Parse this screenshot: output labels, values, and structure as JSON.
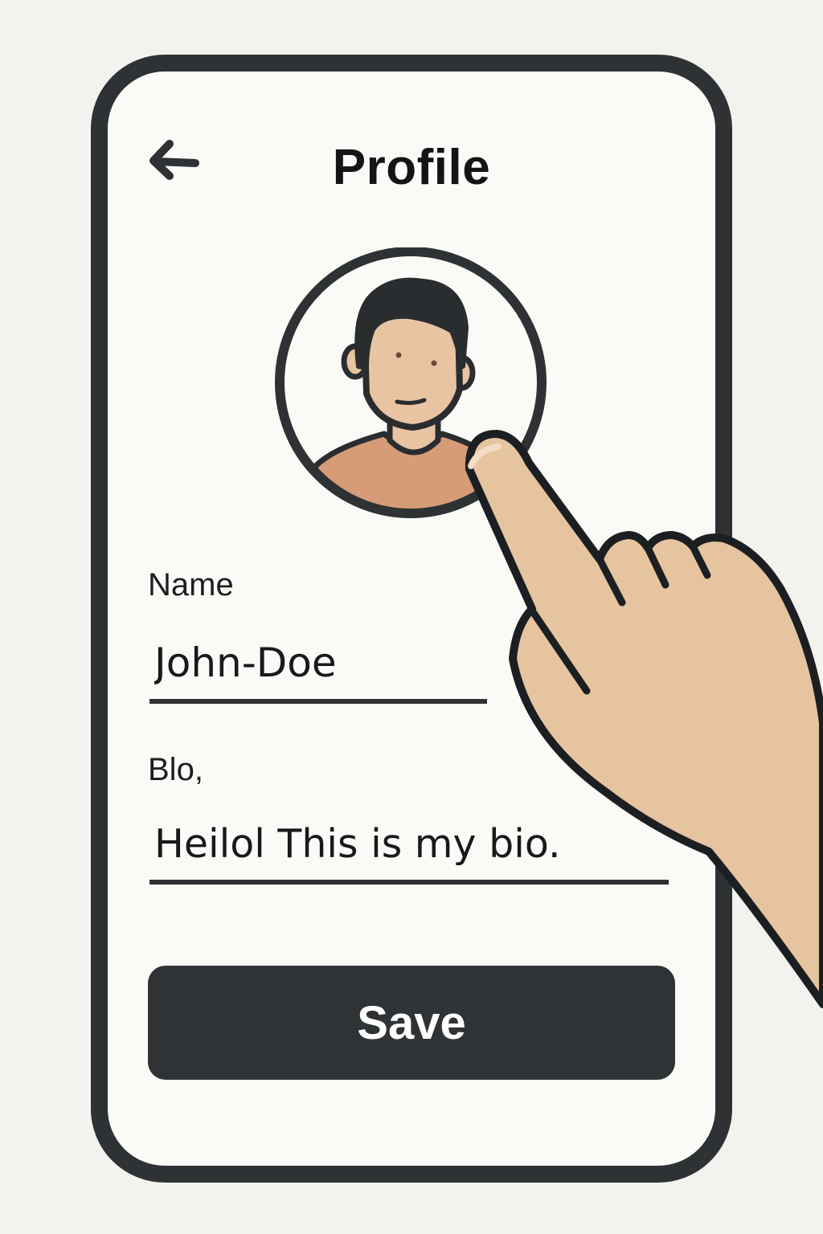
{
  "header": {
    "title": "Profile",
    "back_icon": "arrow-left-icon"
  },
  "avatar": {
    "icon": "user-avatar-icon",
    "shirt_color": "#d69b77",
    "skin_color": "#e8c4a3"
  },
  "form": {
    "name_label": "Name",
    "name_value": "John-Doe",
    "bio_label": "Blo,",
    "bio_value": "Heilol This is my bio."
  },
  "actions": {
    "save_label": "Save"
  },
  "colors": {
    "frame": "#2e3234",
    "screen_background": "#fbfaf7",
    "button_background": "#2f3335",
    "button_text": "#ffffff"
  },
  "overlay": {
    "pointer": "tapping-hand-icon"
  }
}
